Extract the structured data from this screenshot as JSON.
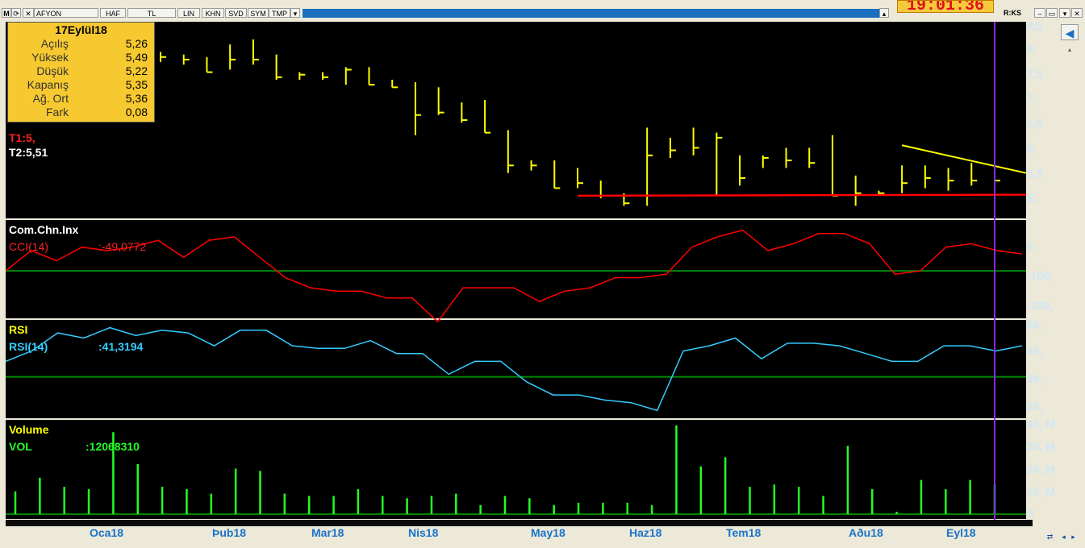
{
  "toolbar": {
    "symbol_prefix": "M",
    "symbol": "AFYON",
    "buttons": [
      "HAF",
      "TL",
      "LIN",
      "KHN",
      "SVD",
      "SYM",
      "TMP"
    ],
    "clock": "19:01:36",
    "right_label": "R:KS"
  },
  "info": {
    "date": "17Eylül18",
    "rows": [
      {
        "label": "Açılış",
        "value": "5,26"
      },
      {
        "label": "Yüksek",
        "value": "5,49"
      },
      {
        "label": "Düşük",
        "value": "5,22"
      },
      {
        "label": "Kapanış",
        "value": "5,35"
      },
      {
        "label": "Ağ. Ort",
        "value": "5,36"
      },
      {
        "label": "Fark",
        "value": "0,08"
      }
    ],
    "t1": "T1:5,",
    "t2": "T2:5,51"
  },
  "cci": {
    "title": "Com.Chn.Inx",
    "name": "CCI(14)",
    "value": ":-49,0772"
  },
  "rsi": {
    "title": "RSI",
    "name": "RSI(14)",
    "value": ":41,3194"
  },
  "volume": {
    "title": "Volume",
    "name": "VOL",
    "value": ":12068310"
  },
  "axes": {
    "price": [
      "8,5",
      "8,",
      "7,5",
      "7,",
      "6,5",
      "6,",
      "5,5",
      "5,"
    ],
    "cci": [
      "0",
      "-100,",
      "-200,"
    ],
    "rsi": [
      "50,",
      "40,",
      "30,",
      "20,"
    ],
    "vol": [
      "40, M",
      "30, M",
      "20, M",
      "10, M",
      "0"
    ],
    "months": [
      "Oca18",
      "Þub18",
      "Mar18",
      "Nis18",
      "May18",
      "Haz18",
      "Tem18",
      "Aðu18",
      "Eyl18"
    ]
  },
  "colors": {
    "background": "#000000",
    "price": "#ffff00",
    "support": "#ff0000",
    "cci": "#ff0000",
    "rsi": "#33ccff",
    "volume": "#22ff22",
    "reference": "#008800",
    "cursor": "#8a2be2"
  },
  "chart_data": [
    {
      "type": "bar",
      "subtype": "ohlc",
      "ylim": [
        4.6,
        8.5
      ],
      "close": [
        7.8,
        7.75,
        7.5,
        7.75,
        7.75,
        7.4,
        7.45,
        7.4,
        7.55,
        7.25,
        7.2,
        6.65,
        6.7,
        6.55,
        6.3,
        5.65,
        5.65,
        5.2,
        5.3,
        5.05,
        4.9,
        5.85,
        5.95,
        6.0,
        6.2,
        5.4,
        5.8,
        5.75,
        5.7,
        5.05,
        5.1,
        5.1,
        5.3,
        5.4,
        5.35,
        5.35,
        5.35
      ],
      "high": [
        7.9,
        7.85,
        7.8,
        8.05,
        8.15,
        7.85,
        7.5,
        7.5,
        7.6,
        7.6,
        7.35,
        7.3,
        7.2,
        6.9,
        6.95,
        6.35,
        5.75,
        5.75,
        5.6,
        5.35,
        5.1,
        6.4,
        6.2,
        6.4,
        6.3,
        5.85,
        5.85,
        6.0,
        6.0,
        6.25,
        5.45,
        5.15,
        5.65,
        5.65,
        5.6,
        5.7,
        5.49
      ],
      "low": [
        7.7,
        7.65,
        7.5,
        7.55,
        7.65,
        7.35,
        7.35,
        7.35,
        7.25,
        7.25,
        7.2,
        6.25,
        6.65,
        6.5,
        6.3,
        5.5,
        5.55,
        5.2,
        5.2,
        5.0,
        4.85,
        4.85,
        5.8,
        5.85,
        5.05,
        5.25,
        5.6,
        5.6,
        5.6,
        5.05,
        4.85,
        5.05,
        5.1,
        5.2,
        5.15,
        5.25,
        5.22
      ],
      "trendlines": [
        {
          "name": "support",
          "from": [
            18,
            5.05
          ],
          "to": [
            40,
            5.07
          ]
        },
        {
          "name": "resistance",
          "from": [
            32,
            6.05
          ],
          "to": [
            40,
            5.5
          ]
        }
      ]
    },
    {
      "type": "line",
      "name": "CCI(14)",
      "ylim": [
        -240,
        50
      ],
      "reference": -100,
      "values": [
        -100,
        -40,
        -70,
        -30,
        -40,
        -30,
        -10,
        -60,
        -10,
        0,
        -60,
        -120,
        -150,
        -160,
        -160,
        -180,
        -180,
        -250,
        -150,
        -150,
        -150,
        -190,
        -160,
        -150,
        -120,
        -120,
        -110,
        -30,
        0,
        20,
        -40,
        -20,
        10,
        10,
        -20,
        -110,
        -100,
        -30,
        -20,
        -40,
        -50
      ],
      "last": -49.0772
    },
    {
      "type": "line",
      "name": "RSI(14)",
      "ylim": [
        14,
        52
      ],
      "reference": 30,
      "values": [
        36,
        40,
        47,
        45,
        49,
        46,
        48,
        47,
        42,
        48,
        48,
        42,
        41,
        41,
        44,
        39,
        39,
        31,
        36,
        36,
        28,
        23,
        23,
        21,
        20,
        17,
        40,
        42,
        45,
        37,
        43,
        43,
        42,
        39,
        36,
        36,
        42,
        42,
        40,
        42
      ],
      "last": 41.3194
    },
    {
      "type": "bar",
      "name": "VOL",
      "ylim": [
        0,
        40
      ],
      "values": [
        10,
        16,
        12,
        11,
        36,
        22,
        12,
        11,
        9,
        20,
        19,
        9,
        8,
        8,
        11,
        8,
        7,
        8,
        9,
        4,
        8,
        7,
        4,
        5,
        5,
        5,
        4,
        39,
        21,
        25,
        12,
        13,
        12,
        8,
        30,
        11,
        1,
        15,
        11,
        15,
        13
      ],
      "last": 12068310
    }
  ]
}
